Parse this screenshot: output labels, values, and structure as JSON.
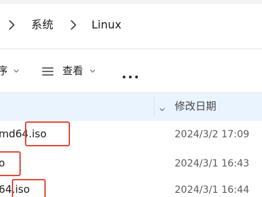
{
  "breadcrumb": {
    "items": [
      "系统",
      "Linux"
    ]
  },
  "toolbar": {
    "sort_label": "序",
    "view_label": "查看",
    "more_label": "···"
  },
  "columns": {
    "modified_label": "修改日期"
  },
  "files": [
    {
      "name": "md64.iso",
      "modified": "2024/3/2 17:09"
    },
    {
      "name": "o",
      "modified": "2024/3/1 16:43"
    },
    {
      "name": "64.iso",
      "modified": "2024/3/1 16:44"
    }
  ],
  "colors": {
    "header_background": "#eaf4fe",
    "highlight_border": "#e04a3a",
    "date_text": "#5b5b5b"
  },
  "icons": [
    "chevron-right-icon",
    "chevron-down-icon",
    "view-lines-icon",
    "more-dots-icon",
    "sort-chevron-icon"
  ]
}
